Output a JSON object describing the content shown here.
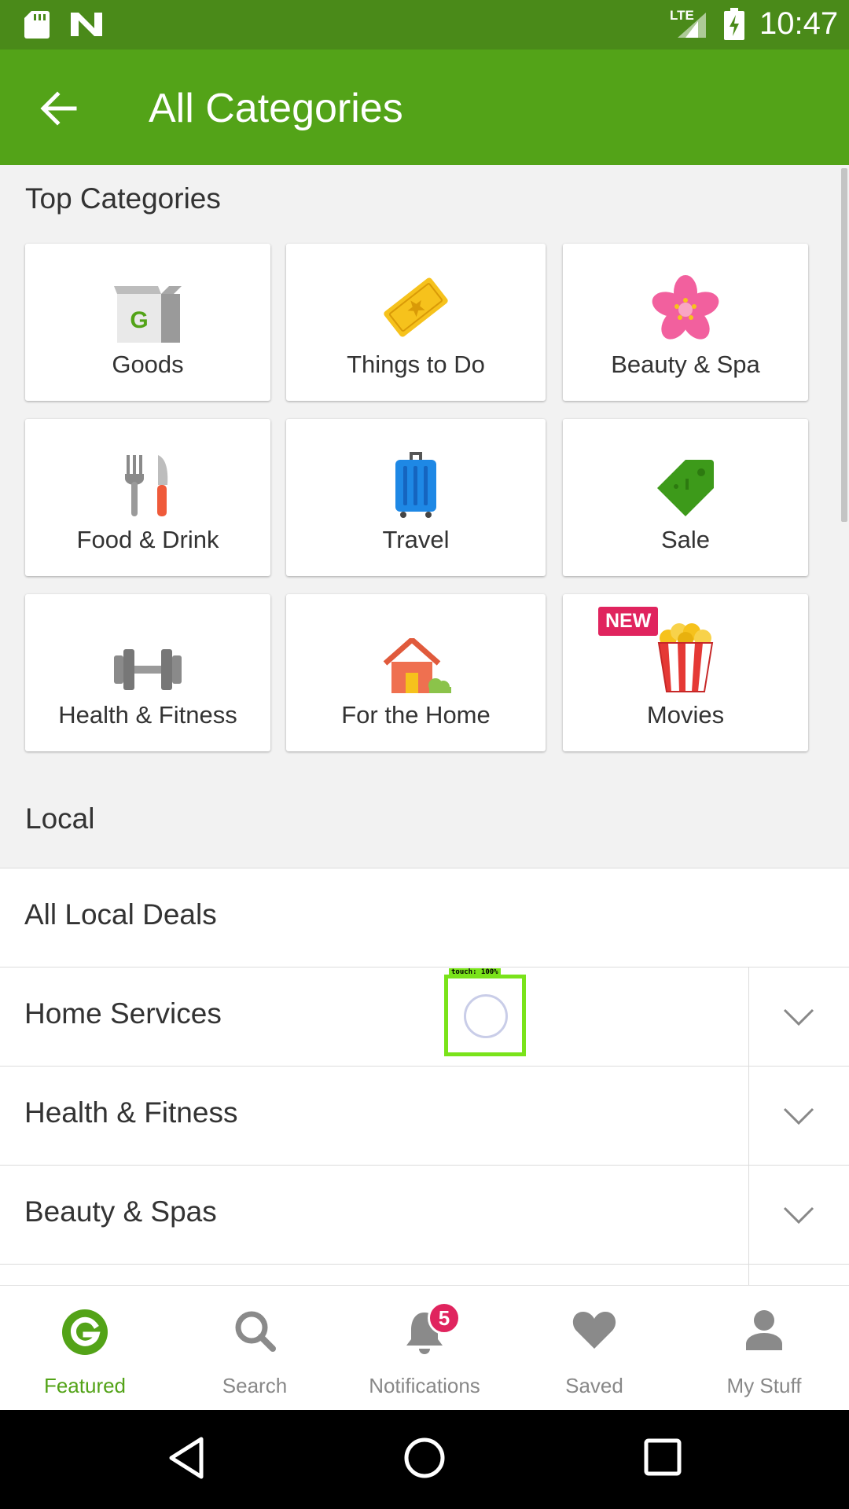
{
  "status_bar": {
    "network": "LTE",
    "time": "10:47",
    "icons": [
      "sd-card-icon",
      "n-icon",
      "signal-icon",
      "battery-charging-icon"
    ]
  },
  "app_bar": {
    "title": "All Categories",
    "back_icon": "arrow-back-icon"
  },
  "top_categories": {
    "title": "Top Categories",
    "items": [
      {
        "label": "Goods",
        "icon": "goods-box-icon"
      },
      {
        "label": "Things to Do",
        "icon": "ticket-icon"
      },
      {
        "label": "Beauty & Spa",
        "icon": "flower-icon"
      },
      {
        "label": "Food & Drink",
        "icon": "fork-knife-icon"
      },
      {
        "label": "Travel",
        "icon": "suitcase-icon"
      },
      {
        "label": "Sale",
        "icon": "price-tag-icon"
      },
      {
        "label": "Health & Fitness",
        "icon": "dumbbell-icon"
      },
      {
        "label": "For the Home",
        "icon": "house-icon"
      },
      {
        "label": "Movies",
        "icon": "popcorn-icon",
        "badge": "NEW"
      }
    ]
  },
  "local": {
    "title": "Local",
    "items": [
      {
        "label": "All Local Deals",
        "expandable": false
      },
      {
        "label": "Home Services",
        "expandable": true
      },
      {
        "label": "Health & Fitness",
        "expandable": true
      },
      {
        "label": "Beauty & Spas",
        "expandable": true
      }
    ]
  },
  "touch_overlay": {
    "label": "touch: 100%"
  },
  "bottom_nav": {
    "items": [
      {
        "label": "Featured",
        "icon": "groupon-g-icon",
        "active": true
      },
      {
        "label": "Search",
        "icon": "search-icon",
        "active": false
      },
      {
        "label": "Notifications",
        "icon": "bell-icon",
        "active": false,
        "badge": "5"
      },
      {
        "label": "Saved",
        "icon": "heart-icon",
        "active": false
      },
      {
        "label": "My Stuff",
        "icon": "person-icon",
        "active": false
      }
    ]
  },
  "colors": {
    "status_bar": "#4a8a19",
    "app_bar": "#53a318",
    "accent": "#53a318",
    "badge": "#e0245e"
  }
}
